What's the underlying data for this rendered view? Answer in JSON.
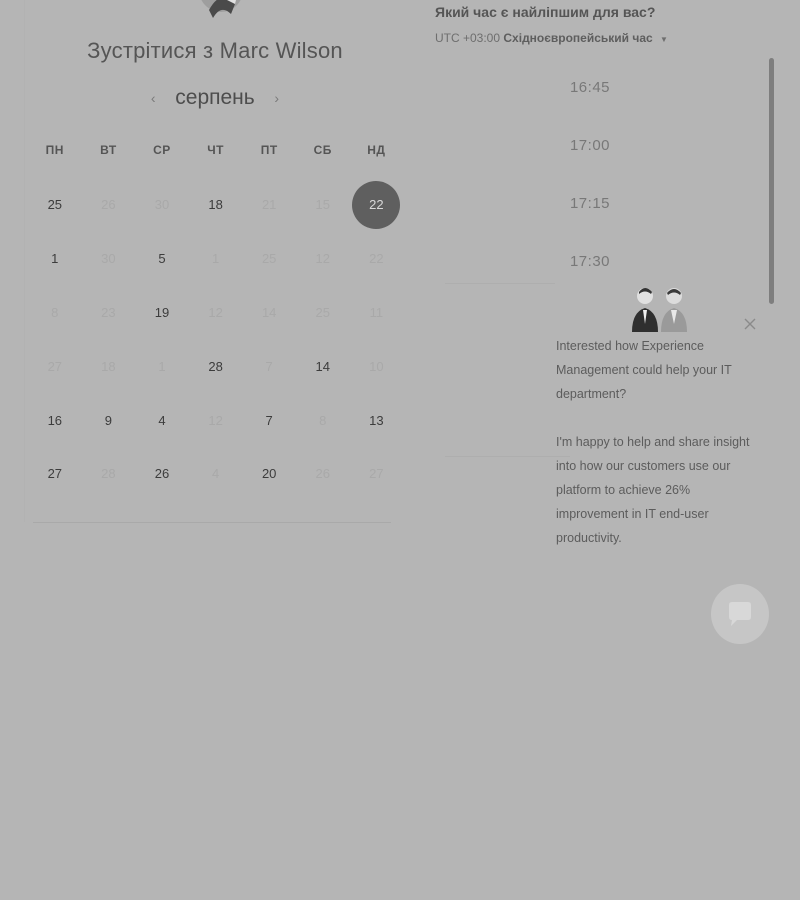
{
  "scheduler": {
    "title": "Зустрітися з Marc Wilson",
    "month": "серпень",
    "weekdays": [
      "ПН",
      "ВТ",
      "СР",
      "ЧТ",
      "ПТ",
      "СБ",
      "НД"
    ],
    "days": [
      {
        "label": "25",
        "available": true
      },
      {
        "label": "26",
        "available": false
      },
      {
        "label": "30",
        "available": false
      },
      {
        "label": "18",
        "available": true
      },
      {
        "label": "21",
        "available": false
      },
      {
        "label": "15",
        "available": false
      },
      {
        "label": "22",
        "available": true,
        "selected": true
      },
      {
        "label": "1",
        "available": true
      },
      {
        "label": "30",
        "available": false
      },
      {
        "label": "5",
        "available": true
      },
      {
        "label": "1",
        "available": false
      },
      {
        "label": "25",
        "available": false
      },
      {
        "label": "12",
        "available": false
      },
      {
        "label": "22",
        "available": false
      },
      {
        "label": "8",
        "available": false
      },
      {
        "label": "23",
        "available": false
      },
      {
        "label": "19",
        "available": true
      },
      {
        "label": "12",
        "available": false
      },
      {
        "label": "14",
        "available": false
      },
      {
        "label": "25",
        "available": false
      },
      {
        "label": "11",
        "available": false
      },
      {
        "label": "27",
        "available": false
      },
      {
        "label": "18",
        "available": false
      },
      {
        "label": "1",
        "available": false
      },
      {
        "label": "28",
        "available": true
      },
      {
        "label": "7",
        "available": false
      },
      {
        "label": "14",
        "available": true
      },
      {
        "label": "10",
        "available": false
      },
      {
        "label": "16",
        "available": true
      },
      {
        "label": "9",
        "available": true
      },
      {
        "label": "4",
        "available": true
      },
      {
        "label": "12",
        "available": false
      },
      {
        "label": "7",
        "available": true
      },
      {
        "label": "8",
        "available": false
      },
      {
        "label": "13",
        "available": true
      },
      {
        "label": "27",
        "available": true
      },
      {
        "label": "28",
        "available": false
      },
      {
        "label": "26",
        "available": true
      },
      {
        "label": "4",
        "available": false
      },
      {
        "label": "20",
        "available": true
      },
      {
        "label": "26",
        "available": false
      },
      {
        "label": "27",
        "available": false
      }
    ]
  },
  "times": {
    "question": "Який час є найліпшим для вас?",
    "tz_offset": "UTC +03:00",
    "tz_name": "Східноєвропейський час",
    "slots": [
      "16:45",
      "17:00",
      "17:15",
      "17:30"
    ]
  },
  "chat": {
    "paragraph1": "Interested how Experience Management could help your IT department?",
    "paragraph2": "I'm happy to help and share insight into how our customers use our platform to achieve 26% improvement in IT end-user productivity."
  },
  "colors": {
    "overlay": "#b5b5b5",
    "selected_day": "#5f5f5f",
    "scrollbar": "#7e7e7e",
    "chat_button": "#c6c6c6"
  }
}
